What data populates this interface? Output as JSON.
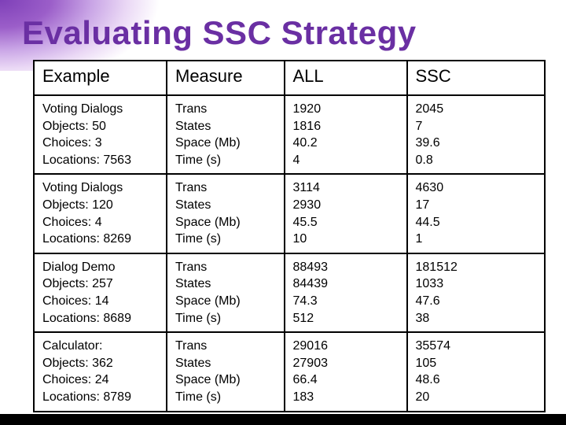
{
  "title": "Evaluating SSC Strategy",
  "headers": [
    "Example",
    "Measure",
    "ALL",
    "SSC"
  ],
  "rows": [
    {
      "example": [
        "Voting Dialogs",
        "Objects: 50",
        "Choices: 3",
        "Locations: 7563"
      ],
      "measure": [
        "Trans",
        "States",
        "Space (Mb)",
        "Time (s)"
      ],
      "all": [
        "1920",
        "1816",
        "40.2",
        "4"
      ],
      "ssc": [
        "2045",
        "7",
        "39.6",
        "0.8"
      ]
    },
    {
      "example": [
        "Voting Dialogs",
        "Objects: 120",
        "Choices: 4",
        "Locations: 8269"
      ],
      "measure": [
        "Trans",
        "States",
        "Space (Mb)",
        "Time (s)"
      ],
      "all": [
        "3114",
        "2930",
        "45.5",
        "10"
      ],
      "ssc": [
        "4630",
        "17",
        "44.5",
        "1"
      ]
    },
    {
      "example": [
        "Dialog Demo",
        "Objects: 257",
        "Choices: 14",
        "Locations: 8689"
      ],
      "measure": [
        "Trans",
        "States",
        "Space (Mb)",
        "Time (s)"
      ],
      "all": [
        "88493",
        "84439",
        "74.3",
        "512"
      ],
      "ssc": [
        "181512",
        "1033",
        "47.6",
        "38"
      ]
    },
    {
      "example": [
        "Calculator:",
        "Objects: 362",
        "Choices: 24",
        "Locations: 8789"
      ],
      "measure": [
        "Trans",
        "States",
        "Space (Mb)",
        "Time (s)"
      ],
      "all": [
        "29016",
        "27903",
        "66.4",
        "183"
      ],
      "ssc": [
        "35574",
        "105",
        "48.6",
        "20"
      ]
    }
  ],
  "chart_data": {
    "type": "table",
    "title": "Evaluating SSC Strategy",
    "columns": [
      "Example",
      "Measure",
      "ALL",
      "SSC"
    ],
    "records": [
      {
        "example": "Voting Dialogs (Objects 50, Choices 3, Locations 7563)",
        "measure": "Trans",
        "ALL": 1920,
        "SSC": 2045
      },
      {
        "example": "Voting Dialogs (Objects 50, Choices 3, Locations 7563)",
        "measure": "States",
        "ALL": 1816,
        "SSC": 7
      },
      {
        "example": "Voting Dialogs (Objects 50, Choices 3, Locations 7563)",
        "measure": "Space (Mb)",
        "ALL": 40.2,
        "SSC": 39.6
      },
      {
        "example": "Voting Dialogs (Objects 50, Choices 3, Locations 7563)",
        "measure": "Time (s)",
        "ALL": 4,
        "SSC": 0.8
      },
      {
        "example": "Voting Dialogs (Objects 120, Choices 4, Locations 8269)",
        "measure": "Trans",
        "ALL": 3114,
        "SSC": 4630
      },
      {
        "example": "Voting Dialogs (Objects 120, Choices 4, Locations 8269)",
        "measure": "States",
        "ALL": 2930,
        "SSC": 17
      },
      {
        "example": "Voting Dialogs (Objects 120, Choices 4, Locations 8269)",
        "measure": "Space (Mb)",
        "ALL": 45.5,
        "SSC": 44.5
      },
      {
        "example": "Voting Dialogs (Objects 120, Choices 4, Locations 8269)",
        "measure": "Time (s)",
        "ALL": 10,
        "SSC": 1
      },
      {
        "example": "Dialog Demo (Objects 257, Choices 14, Locations 8689)",
        "measure": "Trans",
        "ALL": 88493,
        "SSC": 181512
      },
      {
        "example": "Dialog Demo (Objects 257, Choices 14, Locations 8689)",
        "measure": "States",
        "ALL": 84439,
        "SSC": 1033
      },
      {
        "example": "Dialog Demo (Objects 257, Choices 14, Locations 8689)",
        "measure": "Space (Mb)",
        "ALL": 74.3,
        "SSC": 47.6
      },
      {
        "example": "Dialog Demo (Objects 257, Choices 14, Locations 8689)",
        "measure": "Time (s)",
        "ALL": 512,
        "SSC": 38
      },
      {
        "example": "Calculator (Objects 362, Choices 24, Locations 8789)",
        "measure": "Trans",
        "ALL": 29016,
        "SSC": 35574
      },
      {
        "example": "Calculator (Objects 362, Choices 24, Locations 8789)",
        "measure": "States",
        "ALL": 27903,
        "SSC": 105
      },
      {
        "example": "Calculator (Objects 362, Choices 24, Locations 8789)",
        "measure": "Space (Mb)",
        "ALL": 66.4,
        "SSC": 48.6
      },
      {
        "example": "Calculator (Objects 362, Choices 24, Locations 8789)",
        "measure": "Time (s)",
        "ALL": 183,
        "SSC": 20
      }
    ]
  }
}
